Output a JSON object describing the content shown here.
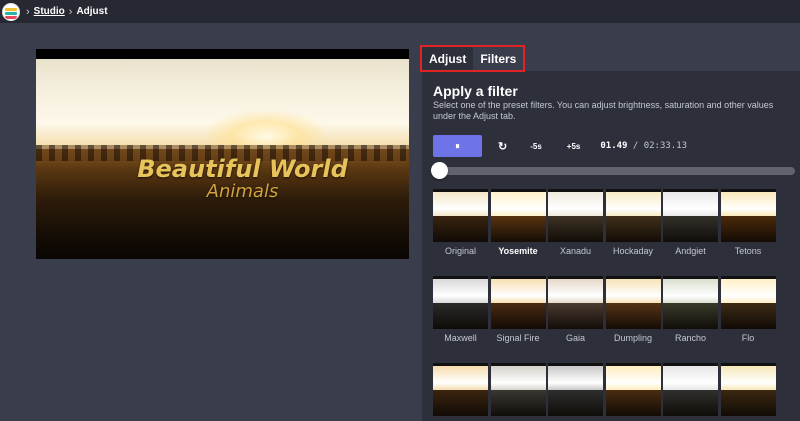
{
  "breadcrumb": {
    "studio": "Studio",
    "current": "Adjust",
    "sep": "›"
  },
  "video": {
    "title_line1": "Beautiful World",
    "title_line2": "Animals"
  },
  "tabs": {
    "adjust": "Adjust",
    "filters": "Filters"
  },
  "panel": {
    "title": "Apply a filter",
    "description": "Select one of the preset filters. You can adjust brightness, saturation and other values under the Adjust tab."
  },
  "controls": {
    "play_icon": "pause-icon",
    "play_glyph": "⏸",
    "replay_glyph": "↻",
    "back_label": "-5s",
    "forward_label": "+5s",
    "current_time": "01.49",
    "time_sep": " / ",
    "duration": "02:33.13",
    "progress": 0.01
  },
  "filters": {
    "selected": "Yosemite",
    "items": [
      {
        "name": "Original",
        "sky": "#f3e6c8",
        "gnd": "#3a2410"
      },
      {
        "name": "Yosemite",
        "sky": "#fff1c9",
        "gnd": "#5a3410"
      },
      {
        "name": "Xanadu",
        "sky": "#eeeadd",
        "gnd": "#3e3325"
      },
      {
        "name": "Hockaday",
        "sky": "#f8ebc5",
        "gnd": "#41301a"
      },
      {
        "name": "Andgiet",
        "sky": "#e9e9ea",
        "gnd": "#34302a"
      },
      {
        "name": "Tetons",
        "sky": "#fbe9b8",
        "gnd": "#4b2a0a"
      },
      {
        "name": "Maxwell",
        "sky": "#d8d8d8",
        "gnd": "#2a2a2a"
      },
      {
        "name": "Signal Fire",
        "sky": "#f6dfb0",
        "gnd": "#4a2a10"
      },
      {
        "name": "Gaia",
        "sky": "#e4d8c8",
        "gnd": "#4a3a30"
      },
      {
        "name": "Dumpling",
        "sky": "#f7e2b6",
        "gnd": "#553315"
      },
      {
        "name": "Rancho",
        "sky": "#d9dfcf",
        "gnd": "#3a3a2c"
      },
      {
        "name": "Flo",
        "sky": "#fff0c6",
        "gnd": "#3d2a14"
      },
      {
        "name": "",
        "sky": "#f5dcae",
        "gnd": "#3c2410"
      },
      {
        "name": "",
        "sky": "#d5d2cc",
        "gnd": "#3a3632"
      },
      {
        "name": "",
        "sky": "#c8c8c8",
        "gnd": "#2e2e2e"
      },
      {
        "name": "",
        "sky": "#ffedc0",
        "gnd": "#4a2c10"
      },
      {
        "name": "",
        "sky": "#e6e6e6",
        "gnd": "#30302c"
      },
      {
        "name": "",
        "sky": "#f7e8b8",
        "gnd": "#3a2810"
      }
    ]
  },
  "colors": {
    "accent": "#6c74e8",
    "highlight_box": "#e02424",
    "topbar": "#262932",
    "panel": "#2d303b",
    "page": "#3a3e4c"
  }
}
